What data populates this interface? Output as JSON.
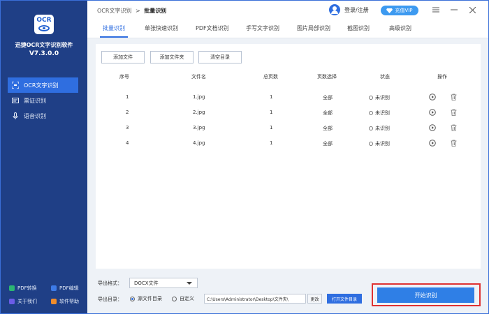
{
  "app": {
    "logo_text": "OCR",
    "name": "迅捷OCR文字识别软件",
    "version": "V7.3.0.0"
  },
  "sidebar": {
    "items": [
      {
        "label": "OCR文字识别",
        "icon": "ocr-icon",
        "active": true
      },
      {
        "label": "票证识别",
        "icon": "ticket-icon",
        "active": false
      },
      {
        "label": "语音识别",
        "icon": "microphone-icon",
        "active": false
      }
    ],
    "bottom_links": [
      {
        "label": "PDF转换",
        "color": "#2bb673"
      },
      {
        "label": "PDF编辑",
        "color": "#3d7be8"
      },
      {
        "label": "关于我们",
        "color": "#6b5ce7"
      },
      {
        "label": "软件帮助",
        "color": "#f08c2b"
      }
    ]
  },
  "header": {
    "breadcrumb_root": "OCR文字识别",
    "breadcrumb_sep": ">",
    "breadcrumb_current": "批量识别",
    "login_label": "登录/注册",
    "vip_label": "充值VIP"
  },
  "tabs": [
    {
      "label": "批量识别",
      "active": true
    },
    {
      "label": "单张快速识别"
    },
    {
      "label": "PDF文档识别"
    },
    {
      "label": "手写文字识别"
    },
    {
      "label": "图片局部识别"
    },
    {
      "label": "截图识别"
    },
    {
      "label": "高级识别"
    }
  ],
  "toolbar": {
    "add_file": "添加文件",
    "add_folder": "添加文件夹",
    "clear_list": "清空目录"
  },
  "table": {
    "headers": [
      "序号",
      "文件名",
      "总页数",
      "页数选择",
      "状态",
      "操作"
    ],
    "rows": [
      {
        "index": "1",
        "filename": "1.jpg",
        "pages": "1",
        "page_select": "全部",
        "status": "未识别"
      },
      {
        "index": "2",
        "filename": "2.jpg",
        "pages": "1",
        "page_select": "全部",
        "status": "未识别"
      },
      {
        "index": "3",
        "filename": "3.jpg",
        "pages": "1",
        "page_select": "全部",
        "status": "未识别"
      },
      {
        "index": "4",
        "filename": "4.jpg",
        "pages": "1",
        "page_select": "全部",
        "status": "未识别"
      }
    ]
  },
  "export": {
    "format_label": "导出格式：",
    "format_value": "DOCX文件",
    "dir_label": "导出目录：",
    "option_source": "源文件目录",
    "option_custom": "自定义",
    "selected_option": "source",
    "path": "C:\\Users\\Administrator\\Desktop\\文件夹\\",
    "change_label": "更改",
    "open_folder_label": "打开文件目录",
    "start_label": "开始识别"
  },
  "colors": {
    "sidebar_bg": "#1f3f86",
    "accent": "#2f6ee0",
    "highlight_border": "#e03232"
  }
}
